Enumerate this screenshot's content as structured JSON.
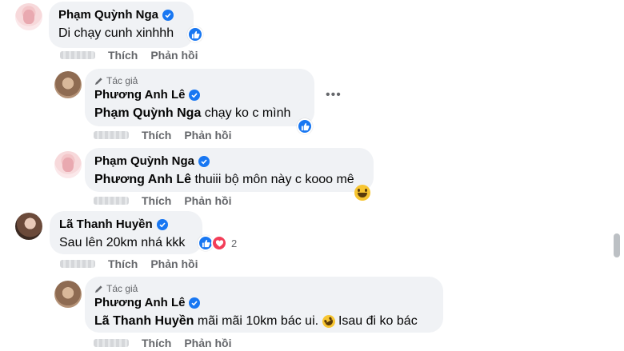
{
  "comments": [
    {
      "author": "Phạm Quỳnh Nga",
      "text": "Di chạy cunh xinhhh",
      "like": "Thích",
      "reply": "Phản hồi"
    },
    {
      "badge": "Tác giả",
      "author": "Phương Anh Lê",
      "mention": "Phạm Quỳnh Nga",
      "text": " chạy ko c mình",
      "like": "Thích",
      "reply": "Phản hồi"
    },
    {
      "author": "Phạm Quỳnh Nga",
      "mention": "Phương Anh Lê",
      "text": " thuiii bộ môn này c kooo mê",
      "like": "Thích",
      "reply": "Phản hồi"
    },
    {
      "author": "Lã Thanh Huyền",
      "text": "Sau lên 20km nhá kkk",
      "reaction_count": "2",
      "like": "Thích",
      "reply": "Phản hồi"
    },
    {
      "badge": "Tác giả",
      "author": "Phương Anh Lê",
      "mention": "Lã Thanh Huyền",
      "text": " mãi mãi 10km bác ui.",
      "text_after": " Isau đi ko bác",
      "like": "Thích",
      "reply": "Phản hồi"
    }
  ],
  "more_label": "•••",
  "colors": {
    "bubble": "#f0f2f5",
    "verified": "#1877f2",
    "meta": "#65676b"
  },
  "icons": {
    "verified": "verified-badge-icon",
    "like": "like-reaction-icon",
    "heart": "heart-reaction-icon",
    "author_badge": "pencil-icon"
  }
}
